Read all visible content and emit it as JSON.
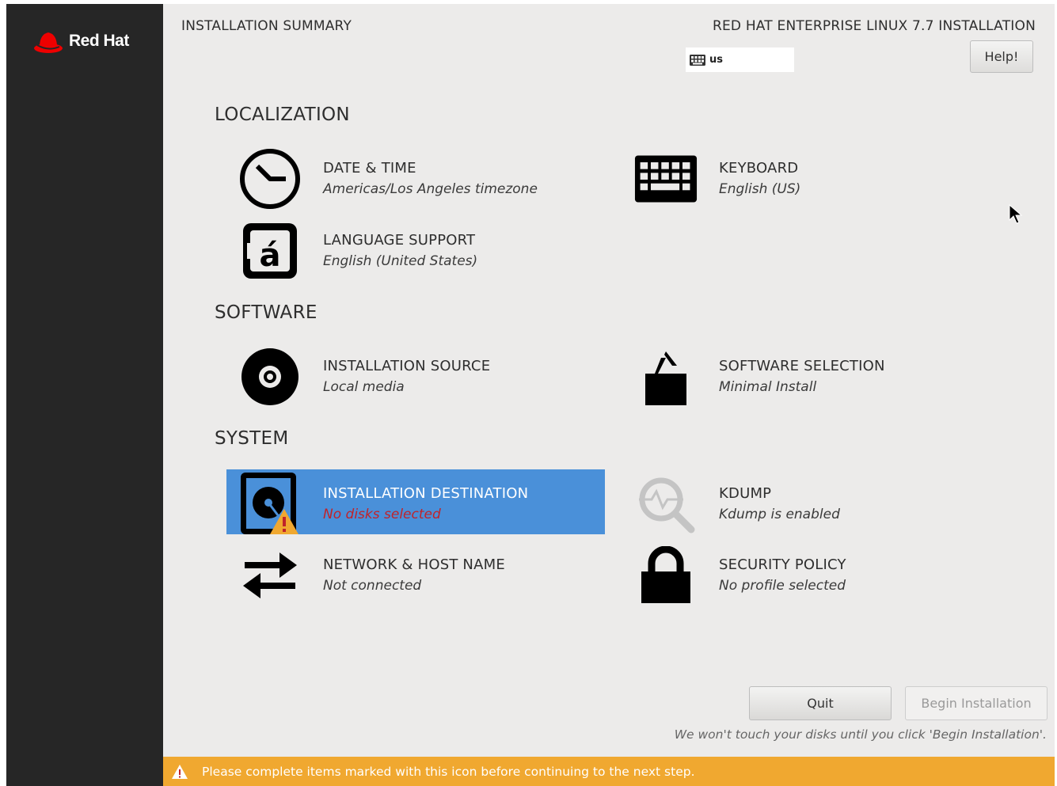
{
  "brand": {
    "name": "Red Hat",
    "logo_color": "#ee0000"
  },
  "header": {
    "title": "INSTALLATION SUMMARY",
    "product": "RED HAT ENTERPRISE LINUX 7.7 INSTALLATION",
    "keyboard_layout": "us",
    "help_label": "Help!"
  },
  "sections": {
    "localization": "LOCALIZATION",
    "software": "SOFTWARE",
    "system": "SYSTEM"
  },
  "spokes": {
    "date_time": {
      "title": "DATE & TIME",
      "status": "Americas/Los Angeles timezone",
      "icon": "clock-icon"
    },
    "keyboard": {
      "title": "KEYBOARD",
      "status": "English (US)",
      "icon": "keyboard-icon"
    },
    "language": {
      "title": "LANGUAGE SUPPORT",
      "status": "English (United States)",
      "icon": "language-icon"
    },
    "source": {
      "title": "INSTALLATION SOURCE",
      "status": "Local media",
      "icon": "disc-icon"
    },
    "software_selection": {
      "title": "SOFTWARE SELECTION",
      "status": "Minimal Install",
      "icon": "package-icon"
    },
    "destination": {
      "title": "INSTALLATION DESTINATION",
      "status": "No disks selected",
      "icon": "harddisk-icon",
      "selected": true,
      "warning": true
    },
    "kdump": {
      "title": "KDUMP",
      "status": "Kdump is enabled",
      "icon": "search-icon"
    },
    "network": {
      "title": "NETWORK & HOST NAME",
      "status": "Not connected",
      "icon": "network-arrows-icon"
    },
    "security": {
      "title": "SECURITY POLICY",
      "status": "No profile selected",
      "icon": "lock-icon"
    }
  },
  "footer": {
    "quit_label": "Quit",
    "begin_label": "Begin Installation",
    "hint": "We won't touch your disks until you click 'Begin Installation'.",
    "warning": "Please complete items marked with this icon before continuing to the next step."
  },
  "colors": {
    "sidebar": "#262626",
    "background": "#ecebea",
    "selected": "#4a90d9",
    "warning": "#f0a830",
    "error_text": "#c0232a"
  }
}
